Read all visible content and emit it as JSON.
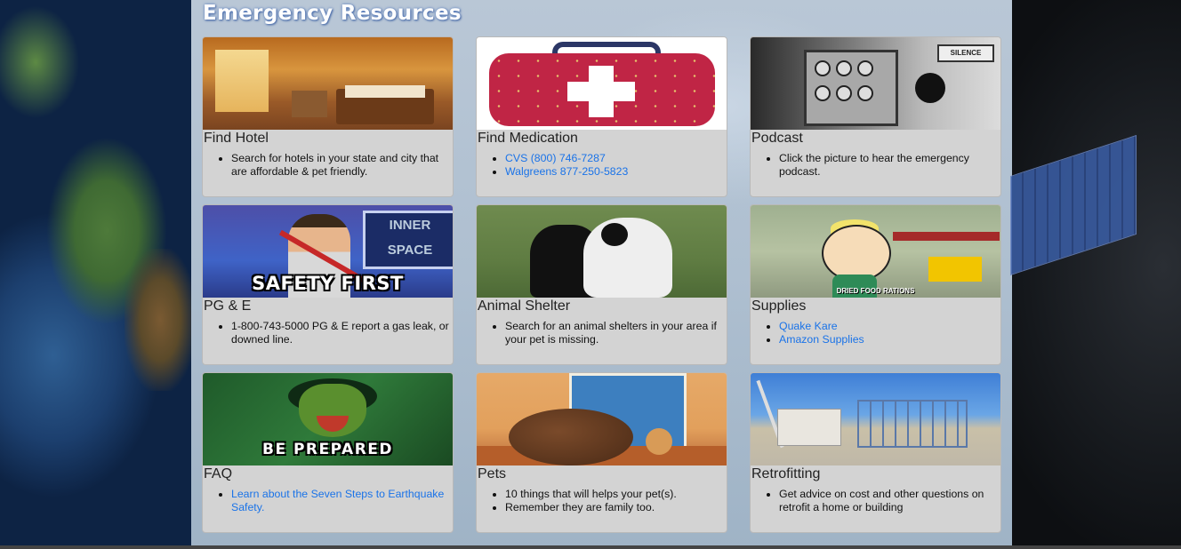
{
  "site": {
    "title": "Emergency Resources"
  },
  "cards": [
    {
      "title": "Find Hotel",
      "image_caption": "",
      "items": [
        "Search for hotels in your state and city that are affordable & pet friendly."
      ]
    },
    {
      "title": "Find Medication",
      "image_caption": "",
      "links": [
        "CVS (800) 746-7287",
        "Walgreens 877-250-5823"
      ]
    },
    {
      "title": "Podcast",
      "image_caption": "SILENCE",
      "items": [
        "Click the picture to hear the emergency podcast."
      ]
    },
    {
      "title": "PG & E",
      "image_caption": "SAFETY FIRST",
      "tv_text": "INNER SPACE",
      "items": [
        "1-800-743-5000 PG & E report a gas leak, or downed line."
      ]
    },
    {
      "title": "Animal Shelter",
      "image_caption": "",
      "items": [
        "Search for an animal shelters in your area if your pet is missing."
      ]
    },
    {
      "title": "Supplies",
      "image_caption": "DRIED FOOD RATIONS",
      "links": [
        "Quake Kare",
        "Amazon Supplies"
      ]
    },
    {
      "title": "FAQ",
      "image_caption": "BE PREPARED",
      "links": [
        "Learn about the Seven Steps to Earthquake Safety."
      ]
    },
    {
      "title": "Pets",
      "image_caption": "",
      "items": [
        "10 things that will helps your pet(s).",
        "Remember they are family too."
      ]
    },
    {
      "title": "Retrofitting",
      "image_caption": "",
      "items": [
        "Get advice on cost and other questions on retrofit a home or building"
      ]
    }
  ],
  "colors": {
    "card_bg": "#d3d3d3",
    "link": "#1a73e8",
    "title": "#ffffff"
  }
}
